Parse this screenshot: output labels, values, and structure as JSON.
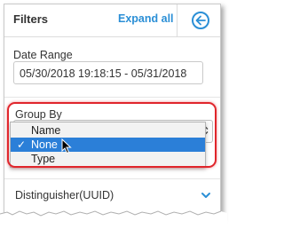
{
  "header": {
    "title": "Filters",
    "expand_all": "Expand all",
    "collapse_icon": "arrow-left-circle-icon"
  },
  "date_range": {
    "label": "Date Range",
    "value": "05/30/2018 19:18:15 - 05/31/2018"
  },
  "group_by": {
    "label": "Group By",
    "selected": "None",
    "options": [
      {
        "label": "Name",
        "selected": false
      },
      {
        "label": "None",
        "selected": true
      },
      {
        "label": "Type",
        "selected": false
      }
    ]
  },
  "distinguisher": {
    "label": "Distinguisher(UUID)",
    "icon": "chevron-down-icon"
  },
  "colors": {
    "accent": "#2b8fd6",
    "selection": "#2b7fd8",
    "highlight": "#e0252b"
  }
}
